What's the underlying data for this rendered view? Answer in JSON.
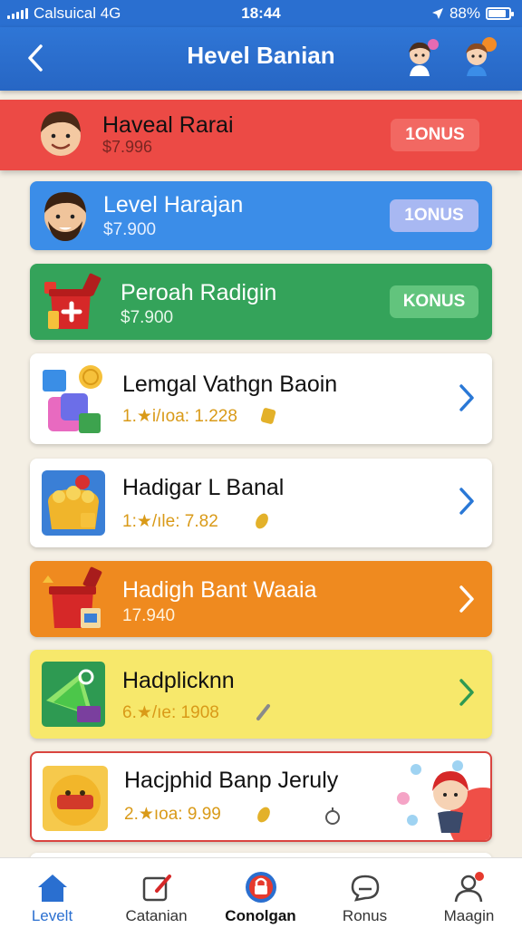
{
  "status_bar": {
    "carrier": "Calsuical 4G",
    "time": "18:44",
    "battery": "88%",
    "battery_level": 0.88
  },
  "header": {
    "title": "Hevel Banian"
  },
  "banner": {
    "title": "Haveal Rarai",
    "subtitle": "$7.996",
    "button": "1ONUS"
  },
  "featured": [
    {
      "title": "Level Harajan",
      "subtitle": "$7.900",
      "button": "1ONUS",
      "color": "#3b8de8"
    },
    {
      "title": "Peroah Radigin",
      "subtitle": "$7.900",
      "button": "KONUS",
      "color": "#34a35a"
    }
  ],
  "list": [
    {
      "title": "Lemgal Vathgn Baoin",
      "meta": "1.★i/ıoa: 1.228"
    },
    {
      "title": "Hadigar L Banal",
      "meta": "1:★/ıle: 7.82"
    },
    {
      "title": "Hadigh Bant Waaia",
      "meta": "17.940"
    },
    {
      "title": "Hadplicknn",
      "meta": "6.★/ıe: 1908"
    },
    {
      "title": "Hacjphid Banp Jeruly",
      "meta": "2.★ıoa: 9.99"
    }
  ],
  "tabs": [
    {
      "label": "Levelt"
    },
    {
      "label": "Catanian"
    },
    {
      "label": "Conolgan"
    },
    {
      "label": "Ronus"
    },
    {
      "label": "Maagin"
    }
  ],
  "colors": {
    "primary": "#2a6fd0",
    "banner": "#ec4a45",
    "accent_gold": "#d99a18",
    "background": "#f4efe4"
  },
  "icons": [
    "back-chevron-icon",
    "avatar-icon",
    "gift-box-icon",
    "chevron-right-icon",
    "home-icon",
    "edit-icon",
    "lock-icon",
    "chat-icon",
    "profile-icon"
  ]
}
